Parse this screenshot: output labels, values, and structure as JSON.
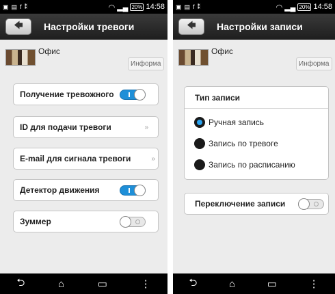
{
  "status_bar": {
    "time": "14:58",
    "battery": "20%"
  },
  "left": {
    "title": "Настройки тревоги",
    "device_name": "Офис",
    "info_label": "Информа",
    "rows": [
      {
        "label": "Получение тревожного",
        "control": "toggle",
        "on": true
      },
      {
        "label": "ID для подачи тревоги",
        "control": "chevron",
        "chevron": "»"
      },
      {
        "label": "E-mail для сигнала тревоги",
        "control": "chevron",
        "chevron": "»"
      },
      {
        "label": "Детектор движения",
        "control": "toggle",
        "on": true
      },
      {
        "label": "Зуммер",
        "control": "toggle",
        "on": false
      }
    ]
  },
  "right": {
    "title": "Настройки записи",
    "device_name": "Офис",
    "info_label": "Информа",
    "record_type_title": "Тип записи",
    "options": [
      {
        "label": "Ручная запись",
        "selected": true
      },
      {
        "label": "Запись по тревоге",
        "selected": false
      },
      {
        "label": "Запись по расписанию",
        "selected": false
      }
    ],
    "switch_label": "Переключение записи",
    "switch_on": false
  },
  "icons": {
    "back": "arrow-left-icon",
    "nav_back": "back-icon",
    "nav_home": "home-icon",
    "nav_recent": "recent-apps-icon",
    "nav_menu": "menu-icon"
  },
  "colors": {
    "accent": "#1e8fd8",
    "titlebar": "#2a2a2a",
    "background": "#ececec"
  }
}
